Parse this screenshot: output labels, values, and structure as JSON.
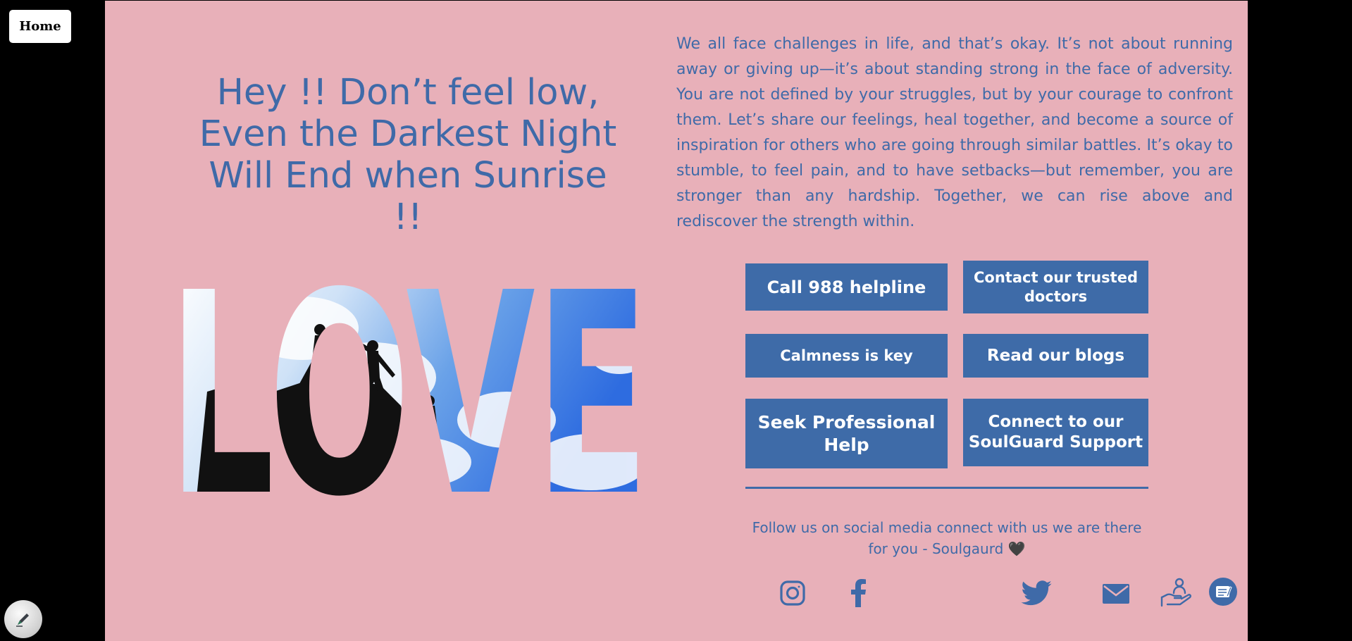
{
  "nav": {
    "home_label": "Home"
  },
  "hero": {
    "headline": "Hey !! Don’t feel low, Even the Darkest Night Will End when Sunrise !!",
    "image_word": "LOVE"
  },
  "intro": {
    "paragraph": "We all face challenges in life, and that’s okay. It’s not about running away or giving up—it’s about standing strong in the face of adversity. You are not defined by your struggles, but by your courage to confront them. Let’s share our feelings, heal together, and become a source of inspiration for others who are going through similar battles. It’s okay to stumble, to feel pain, and to have setbacks—but remember, you are stronger than any hardship. Together, we can rise above and rediscover the strength within."
  },
  "actions": {
    "call_helpline": "Call 988 helpline",
    "contact_doctors": "Contact our trusted doctors",
    "calmness": "Calmness is key",
    "read_blogs": "Read our blogs",
    "seek_help": "Seek Professional Help",
    "connect_support": "Connect to our SoulGuard Support"
  },
  "footer": {
    "follow_text": "Follow us on social media connect with us we are there for you - Soulgaurd",
    "heart": "🖤"
  },
  "social_icons": [
    "instagram-icon",
    "facebook-icon",
    "twitter-icon",
    "mail-icon",
    "helping-hand-icon",
    "notes-icon"
  ],
  "colors": {
    "background": "#e8b0b9",
    "accent": "#3f6aa8",
    "button": "#3e6ba8",
    "page_bg": "#000000"
  }
}
